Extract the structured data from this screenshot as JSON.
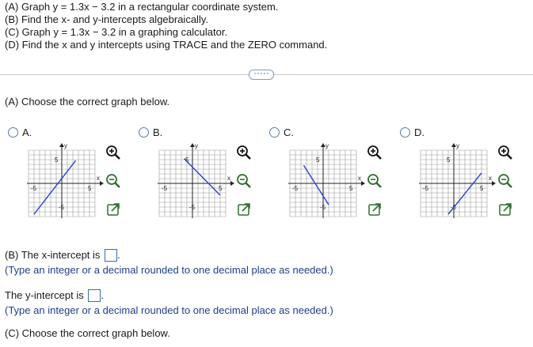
{
  "problem": {
    "lines": [
      "(A) Graph y = 1.3x − 3.2 in a rectangular coordinate system.",
      "(B) Find the x- and y-intercepts algebraically.",
      "(C) Graph y = 1.3x − 3.2 in a graphing calculator.",
      "(D) Find the x and y intercepts using TRACE and the ZERO command."
    ]
  },
  "more_button": "·····",
  "part_a": {
    "prompt": "(A) Choose the correct graph below."
  },
  "options": [
    {
      "letter": "A.",
      "line": [
        [
          -5,
          -6.5
        ],
        [
          2.5,
          4.8
        ]
      ]
    },
    {
      "letter": "B.",
      "line": [
        [
          -1.5,
          5.2
        ],
        [
          5,
          -2.5
        ]
      ]
    },
    {
      "letter": "C.",
      "line": [
        [
          -3.5,
          3.8
        ],
        [
          1,
          -4.5
        ]
      ]
    },
    {
      "letter": "D.",
      "line": [
        [
          -1,
          -6.5
        ],
        [
          5,
          2.2
        ]
      ]
    }
  ],
  "graph_labels": {
    "x_axis": "x",
    "y_axis": "y",
    "tick_pos": "5",
    "tick_neg": "-5",
    "xlim": [
      -6,
      6
    ],
    "ylim": [
      -7,
      7
    ]
  },
  "part_b": {
    "x_prompt": "(B) The x-intercept is",
    "x_hint": "(Type an integer or a decimal rounded to one decimal place as needed.)",
    "y_prompt": "The y-intercept is",
    "y_hint": "(Type an integer or a decimal rounded to one decimal place as needed.)"
  },
  "part_c": {
    "prompt": "(C) Choose the correct graph below."
  },
  "colors": {
    "line": "#2a3fd6",
    "radio_border": "#5b7ba8",
    "hint_text": "#1f3f8a",
    "tool_stroke": "#3a5f3a"
  }
}
